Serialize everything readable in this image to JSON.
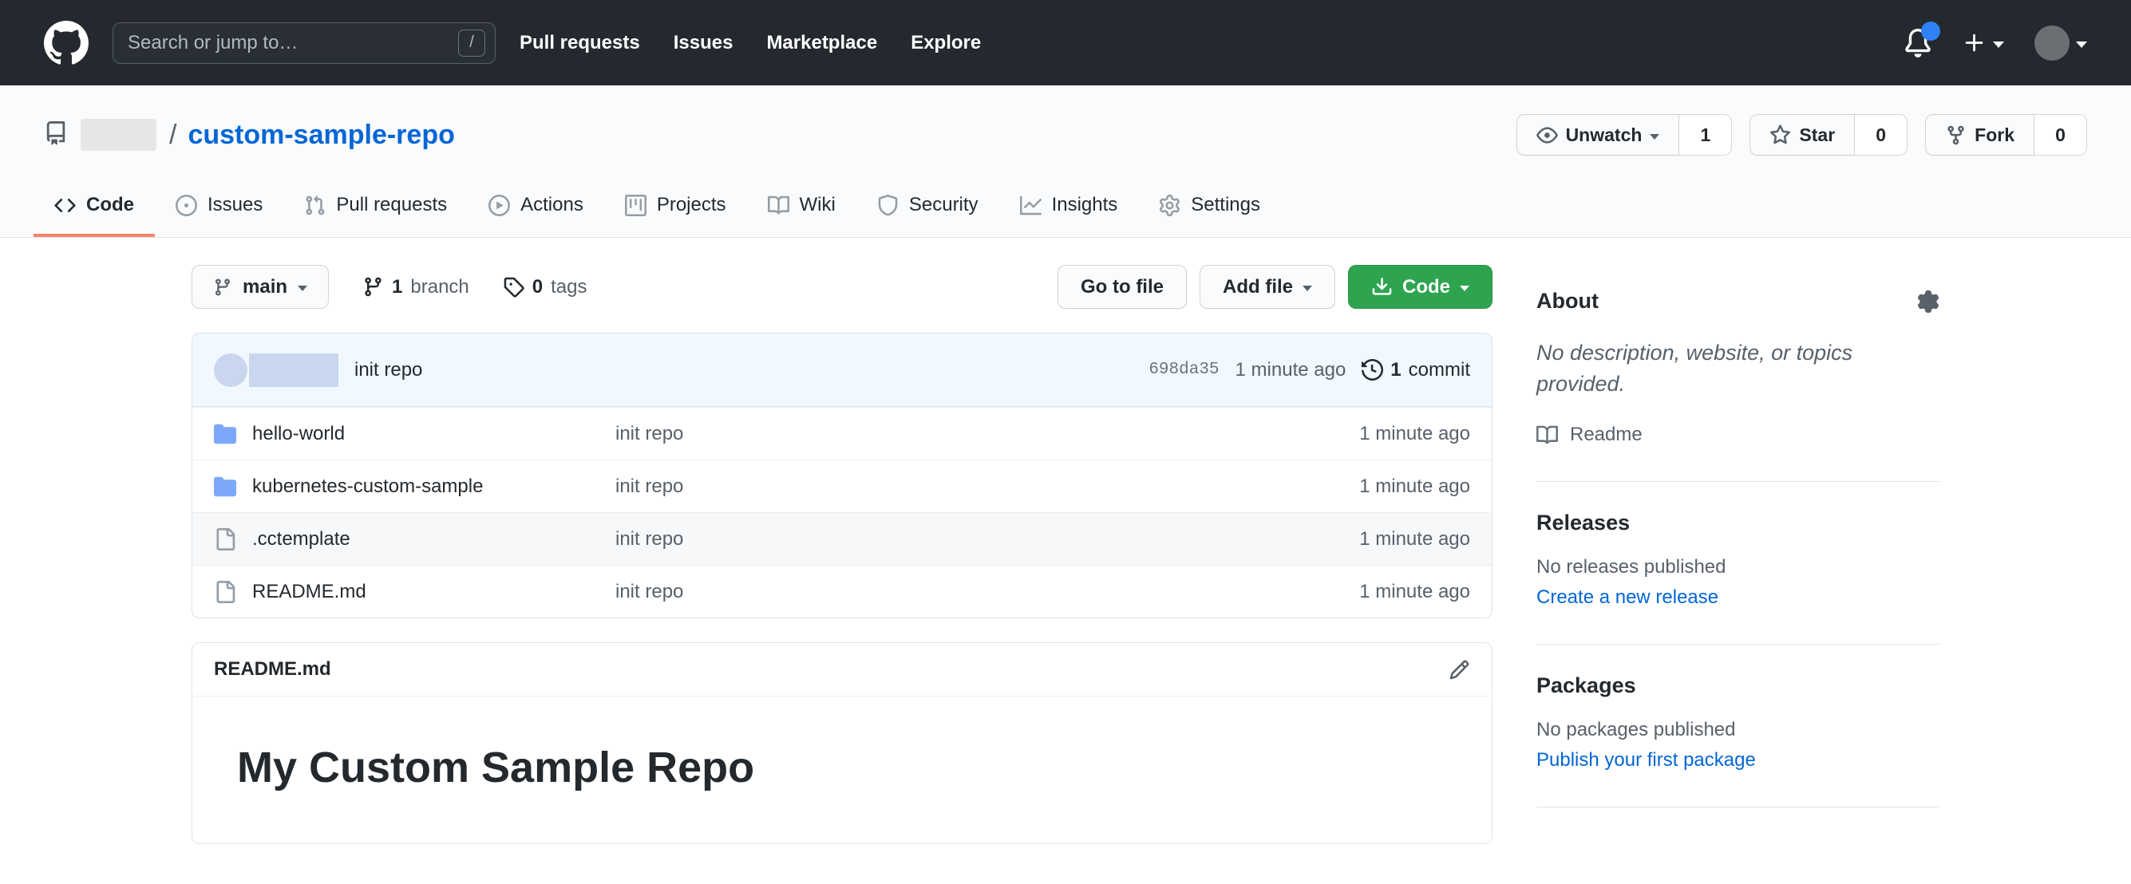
{
  "colors": {
    "header_bg": "#24292f",
    "link_blue": "#0366d6",
    "button_green": "#2ea44f",
    "tab_underline": "#f9826c",
    "commit_bar_bg": "#f1f8ff",
    "folder_icon": "#7da7f8",
    "notification_dot": "#2f81f7",
    "muted_text": "#586069",
    "border": "#e1e4e8"
  },
  "header": {
    "search_placeholder": "Search or jump to…",
    "search_key_hint": "/",
    "nav": [
      "Pull requests",
      "Issues",
      "Marketplace",
      "Explore"
    ]
  },
  "repo_header": {
    "separator": "/",
    "name": "custom-sample-repo",
    "watch": {
      "label": "Unwatch",
      "count": "1"
    },
    "star": {
      "label": "Star",
      "count": "0"
    },
    "fork": {
      "label": "Fork",
      "count": "0"
    }
  },
  "tabs": [
    {
      "label": "Code"
    },
    {
      "label": "Issues"
    },
    {
      "label": "Pull requests"
    },
    {
      "label": "Actions"
    },
    {
      "label": "Projects"
    },
    {
      "label": "Wiki"
    },
    {
      "label": "Security"
    },
    {
      "label": "Insights"
    },
    {
      "label": "Settings"
    }
  ],
  "toolbar": {
    "branch_button": "main",
    "branch_count": "1",
    "branch_label": "branch",
    "tag_count": "0",
    "tag_label": "tags",
    "go_to_file": "Go to file",
    "add_file": "Add file",
    "code_button": "Code"
  },
  "commit_bar": {
    "message": "init repo",
    "hash": "698da35",
    "time": "1 minute ago",
    "commit_count": "1",
    "commit_label": "commit"
  },
  "files": [
    {
      "name": "hello-world",
      "type": "folder",
      "message": "init repo",
      "time": "1 minute ago"
    },
    {
      "name": "kubernetes-custom-sample",
      "type": "folder",
      "message": "init repo",
      "time": "1 minute ago"
    },
    {
      "name": ".cctemplate",
      "type": "file",
      "message": "init repo",
      "time": "1 minute ago"
    },
    {
      "name": "README.md",
      "type": "file",
      "message": "init repo",
      "time": "1 minute ago"
    }
  ],
  "readme": {
    "filename": "README.md",
    "heading": "My Custom Sample Repo"
  },
  "sidebar": {
    "about": {
      "title": "About",
      "description": "No description, website, or topics provided.",
      "readme_label": "Readme"
    },
    "releases": {
      "title": "Releases",
      "empty": "No releases published",
      "link": "Create a new release"
    },
    "packages": {
      "title": "Packages",
      "empty": "No packages published",
      "link": "Publish your first package"
    }
  }
}
